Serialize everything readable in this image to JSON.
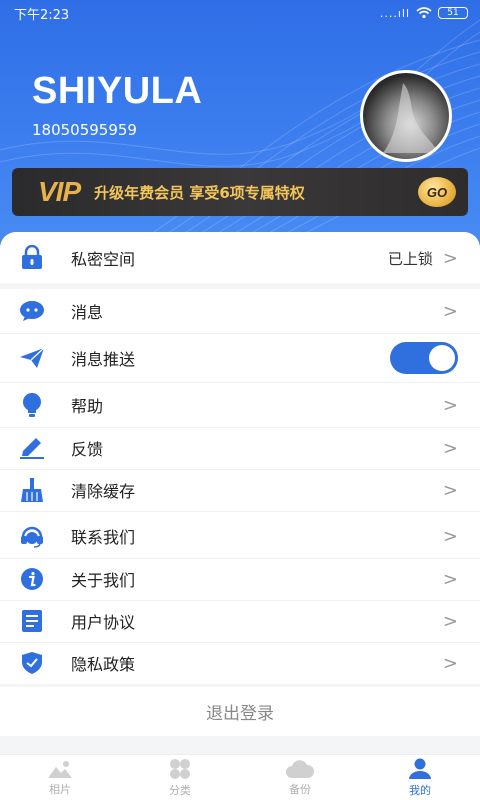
{
  "status_bar": {
    "time": "下午2:23",
    "signal": "....ıll",
    "battery": "51"
  },
  "profile": {
    "username": "SHIYULA",
    "phone": "18050595959"
  },
  "vip_banner": {
    "logo": "VIP",
    "text": "升级年费会员 享受6项专属特权",
    "go_label": "GO"
  },
  "menu": {
    "private_space": {
      "label": "私密空间",
      "value": "已上锁"
    },
    "items": [
      {
        "label": "消息",
        "icon": "chat-bubble-icon"
      },
      {
        "label": "消息推送",
        "icon": "paper-plane-icon",
        "toggle_on": true
      },
      {
        "label": "帮助",
        "icon": "lightbulb-icon"
      },
      {
        "label": "反馈",
        "icon": "pencil-icon"
      },
      {
        "label": "清除缓存",
        "icon": "broom-icon"
      },
      {
        "label": "联系我们",
        "icon": "headset-icon"
      },
      {
        "label": "关于我们",
        "icon": "info-icon"
      },
      {
        "label": "用户协议",
        "icon": "document-icon"
      },
      {
        "label": "隐私政策",
        "icon": "shield-icon"
      }
    ],
    "chevron": ">"
  },
  "logout_label": "退出登录",
  "tabs": [
    {
      "label": "相片",
      "icon": "photo-icon",
      "active": false
    },
    {
      "label": "分类",
      "icon": "category-icon",
      "active": false
    },
    {
      "label": "备份",
      "icon": "cloud-icon",
      "active": false
    },
    {
      "label": "我的",
      "icon": "user-icon",
      "active": true
    }
  ],
  "colors": {
    "accent": "#2f6fde",
    "header": "#3c7eef",
    "vip_gold": "#f3c55a"
  }
}
